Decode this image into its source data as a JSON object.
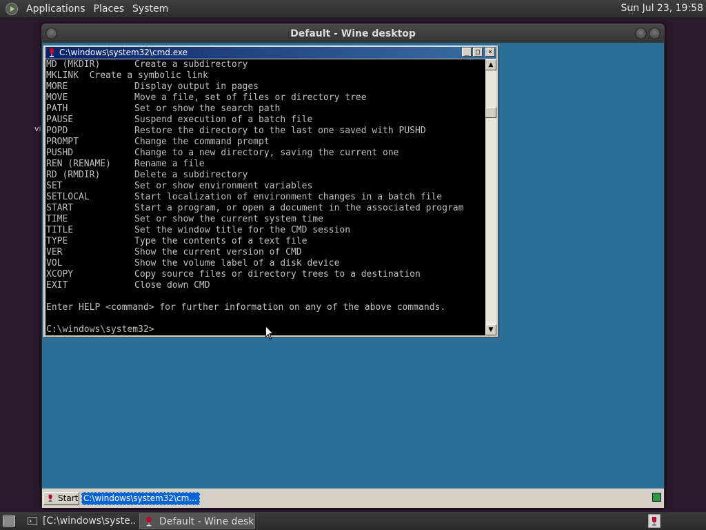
{
  "top_panel": {
    "menus": [
      "Applications",
      "Places",
      "System"
    ],
    "clock": "Sun Jul 23, 19:58"
  },
  "wine_window": {
    "title": "Default - Wine desktop"
  },
  "cmd_window": {
    "title": "C:\\windows\\system32\\cmd.exe",
    "buttons": {
      "minimize": "_",
      "maximize": "□",
      "close": "×"
    },
    "help_entries": [
      {
        "cmd": "MD (MKDIR)",
        "desc": "Create a subdirectory"
      },
      {
        "cmd": "MKLINK  Create a symbolic link",
        "desc": ""
      },
      {
        "cmd": "MORE",
        "desc": "Display output in pages"
      },
      {
        "cmd": "MOVE",
        "desc": "Move a file, set of files or directory tree"
      },
      {
        "cmd": "PATH",
        "desc": "Set or show the search path"
      },
      {
        "cmd": "PAUSE",
        "desc": "Suspend execution of a batch file"
      },
      {
        "cmd": "POPD",
        "desc": "Restore the directory to the last one saved with PUSHD"
      },
      {
        "cmd": "PROMPT",
        "desc": "Change the command prompt"
      },
      {
        "cmd": "PUSHD",
        "desc": "Change to a new directory, saving the current one"
      },
      {
        "cmd": "REN (RENAME)",
        "desc": "Rename a file"
      },
      {
        "cmd": "RD (RMDIR)",
        "desc": "Delete a subdirectory"
      },
      {
        "cmd": "SET",
        "desc": "Set or show environment variables"
      },
      {
        "cmd": "SETLOCAL",
        "desc": "Start localization of environment changes in a batch file"
      },
      {
        "cmd": "START",
        "desc": "Start a program, or open a document in the associated program"
      },
      {
        "cmd": "TIME",
        "desc": "Set or show the current system time"
      },
      {
        "cmd": "TITLE",
        "desc": "Set the window title for the CMD session"
      },
      {
        "cmd": "TYPE",
        "desc": "Type the contents of a text file"
      },
      {
        "cmd": "VER",
        "desc": "Show the current version of CMD"
      },
      {
        "cmd": "VOL",
        "desc": "Show the volume label of a disk device"
      },
      {
        "cmd": "XCOPY",
        "desc": "Copy source files or directory trees to a destination"
      },
      {
        "cmd": "EXIT",
        "desc": "Close down CMD"
      }
    ],
    "help_footer": "Enter HELP <command> for further information on any of the above commands.",
    "prompt": "C:\\windows\\system32>"
  },
  "wine_taskbar": {
    "start_label": "Start",
    "task_label": "C:\\windows\\system32\\cm..."
  },
  "bottom_panel": {
    "tasks": [
      "[C:\\windows\\syste...",
      "Default - Wine desk..."
    ]
  },
  "left_edge_text": "vi",
  "colors": {
    "desktop": "#2b6f96",
    "titlebar_start": "#0a246a",
    "titlebar_end": "#3a6ea5",
    "console_bg": "#000000",
    "console_fg": "#c0c0c0"
  },
  "icons": [
    "gnome-foot-icon",
    "wine-glass-icon",
    "terminal-icon",
    "show-desktop-icon",
    "mouse-cursor-icon"
  ]
}
